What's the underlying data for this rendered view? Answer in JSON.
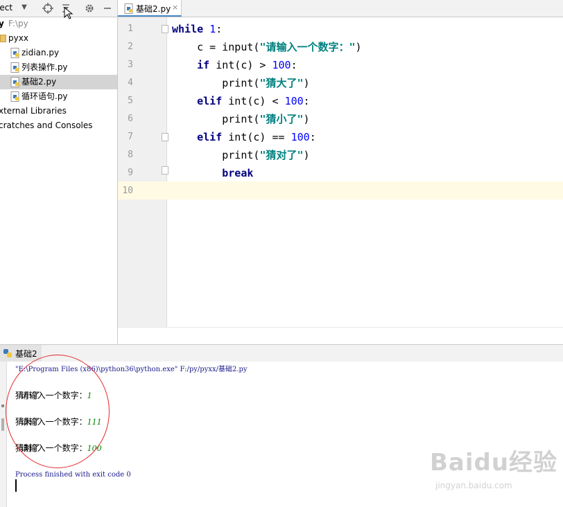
{
  "project_panel": {
    "title": "ject",
    "tree": [
      {
        "label": "y",
        "detail": "F:\\py",
        "indent": 0
      },
      {
        "label": "pyxx",
        "indent": 1
      },
      {
        "label": "zidian.py",
        "indent": 2
      },
      {
        "label": "列表操作.py",
        "indent": 2
      },
      {
        "label": "基础2.py",
        "indent": 2,
        "selected": true
      },
      {
        "label": "循环语句.py",
        "indent": 2
      },
      {
        "label": "xternal Libraries",
        "indent": 0
      },
      {
        "label": "cratches and Consoles",
        "indent": 0
      }
    ]
  },
  "editor": {
    "tab_label": "基础2.py",
    "tab_close": "×",
    "line_numbers": [
      "1",
      "2",
      "3",
      "4",
      "5",
      "6",
      "7",
      "8",
      "9",
      "10"
    ],
    "current_line": "10",
    "code": [
      "while 1:",
      "    c = input(\"请输入一个数字：\")",
      "    if int(c) > 100:",
      "        print(\"猜大了\")",
      "    elif int(c) < 100:",
      "        print(\"猜小了\")",
      "    elif int(c) == 100:",
      "        print(\"猜对了\")",
      "        break",
      ""
    ]
  },
  "run_panel": {
    "tab_label": "基础2",
    "console": {
      "command": "\"E:\\Program Files (x86)\\python36\\python.exe\" F:/py/pyxx/基础2.py",
      "lines": [
        {
          "prompt": "请输入一个数字：",
          "input": "1"
        },
        {
          "text": "猜小了"
        },
        {
          "prompt": "请输入一个数字：",
          "input": "111"
        },
        {
          "text": "猜大了"
        },
        {
          "prompt": "请输入一个数字：",
          "input": "100"
        },
        {
          "text": "猜对了"
        }
      ],
      "exit_message": "Process finished with exit code 0"
    }
  },
  "watermark": {
    "logo_text": "Baidu经验",
    "site": "jingyan.baidu.com"
  },
  "colors": {
    "keyword": "#000080",
    "number": "#0000ff",
    "string": "#008080",
    "input_echo": "#008000",
    "annotation_circle": "#e3282a",
    "current_line_bg": "#fffae3"
  }
}
